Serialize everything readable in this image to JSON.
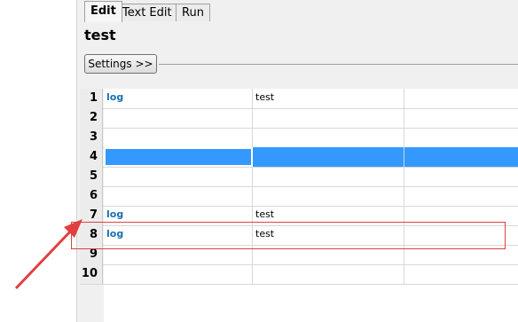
{
  "tabs": [
    {
      "label": "Edit",
      "active": true
    },
    {
      "label": "Text Edit",
      "active": false
    },
    {
      "label": "Run",
      "active": false
    }
  ],
  "title": "test",
  "settings_button": "Settings >>",
  "rows": [
    {
      "num": "1",
      "keyword": "log",
      "arg": "test"
    },
    {
      "num": "2",
      "keyword": "",
      "arg": ""
    },
    {
      "num": "3",
      "keyword": "",
      "arg": ""
    },
    {
      "num": "4",
      "keyword": "",
      "arg": "",
      "selected": true
    },
    {
      "num": "5",
      "keyword": "",
      "arg": ""
    },
    {
      "num": "6",
      "keyword": "",
      "arg": ""
    },
    {
      "num": "7",
      "keyword": "log",
      "arg": "test"
    },
    {
      "num": "8",
      "keyword": "log",
      "arg": "test",
      "highlighted": true
    },
    {
      "num": "9",
      "keyword": "",
      "arg": ""
    },
    {
      "num": "10",
      "keyword": "",
      "arg": ""
    }
  ],
  "colors": {
    "keyword": "#1a6fb0",
    "selection": "#3399ff",
    "annotation": "#e0403f"
  }
}
